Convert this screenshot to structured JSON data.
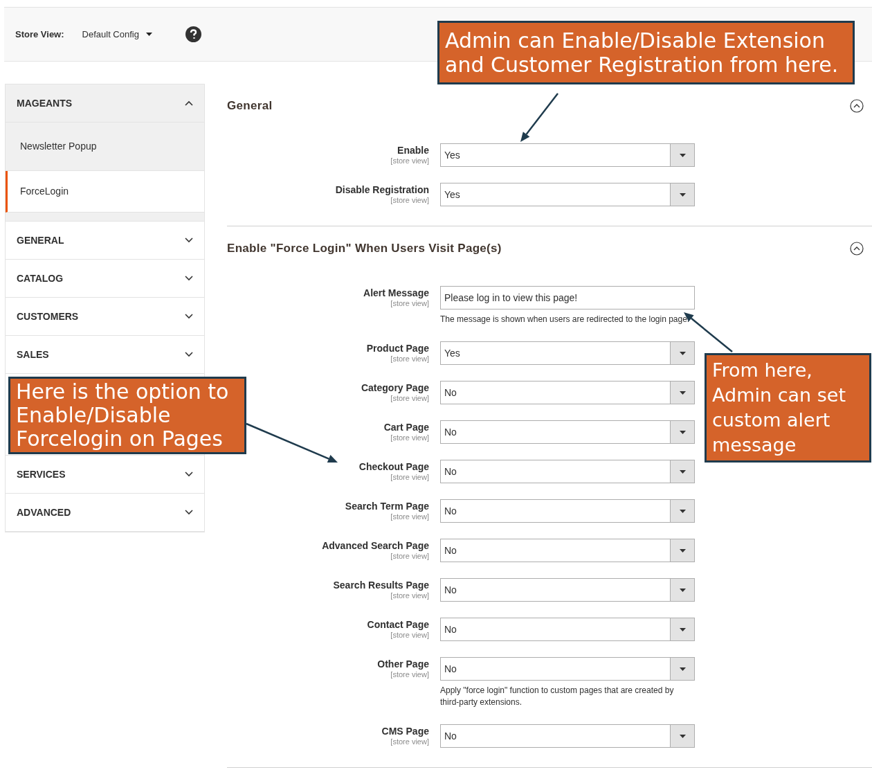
{
  "store_view": {
    "label": "Store View:",
    "value": "Default Config"
  },
  "sidebar": {
    "groups": [
      {
        "title": "MAGEANTS",
        "expanded": true,
        "items": [
          {
            "label": "Newsletter Popup",
            "selected": false
          },
          {
            "label": "ForceLogin",
            "selected": true
          }
        ]
      },
      {
        "title": "GENERAL",
        "expanded": false
      },
      {
        "title": "CATALOG",
        "expanded": false
      },
      {
        "title": "CUSTOMERS",
        "expanded": false
      },
      {
        "title": "SALES",
        "expanded": false
      },
      {
        "title": "SERVICES",
        "expanded": false
      },
      {
        "title": "ADVANCED",
        "expanded": false
      }
    ]
  },
  "sections": [
    {
      "title": "General",
      "expanded": true,
      "fields": [
        {
          "kind": "select",
          "label": "Enable",
          "scope": "[store view]",
          "value": "Yes"
        },
        {
          "kind": "select",
          "label": "Disable Registration",
          "scope": "[store view]",
          "value": "Yes"
        }
      ]
    },
    {
      "title": "Enable \"Force Login\" When Users Visit Page(s)",
      "expanded": true,
      "fields": [
        {
          "kind": "text",
          "label": "Alert Message",
          "scope": "[store view]",
          "value": "Please log in to view this page!",
          "note": "The message is shown when users are redirected to the login page."
        },
        {
          "kind": "select",
          "label": "Product Page",
          "scope": "[store view]",
          "value": "Yes"
        },
        {
          "kind": "select",
          "label": "Category Page",
          "scope": "[store view]",
          "value": "No"
        },
        {
          "kind": "select",
          "label": "Cart Page",
          "scope": "[store view]",
          "value": "No"
        },
        {
          "kind": "select",
          "label": "Checkout Page",
          "scope": "[store view]",
          "value": "No"
        },
        {
          "kind": "select",
          "label": "Search Term Page",
          "scope": "[store view]",
          "value": "No"
        },
        {
          "kind": "select",
          "label": "Advanced Search Page",
          "scope": "[store view]",
          "value": "No"
        },
        {
          "kind": "select",
          "label": "Search Results Page",
          "scope": "[store view]",
          "value": "No"
        },
        {
          "kind": "select",
          "label": "Contact Page",
          "scope": "[store view]",
          "value": "No"
        },
        {
          "kind": "select",
          "label": "Other Page",
          "scope": "[store view]",
          "value": "No",
          "note": "Apply \"force login\" function to custom pages that are created by third-party extensions."
        },
        {
          "kind": "select",
          "label": "CMS Page",
          "scope": "[store view]",
          "value": "No"
        }
      ]
    }
  ],
  "callouts": [
    {
      "text": "Admin can Enable/Disable Extension and Customer Registration from here."
    },
    {
      "text": "Here is the option to Enable/Disable Forcelogin on Pages"
    },
    {
      "text": "From here, Admin can set custom alert message"
    }
  ]
}
